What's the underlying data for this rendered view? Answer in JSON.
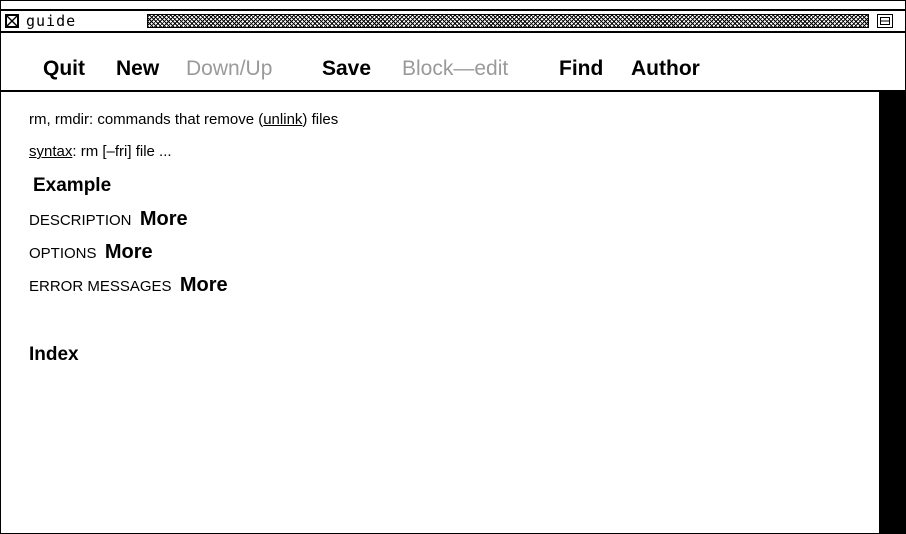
{
  "window": {
    "title": "guide"
  },
  "menu": {
    "quit": "Quit",
    "new": "New",
    "down_up": "Down/Up",
    "save": "Save",
    "block_edit": "Block—edit",
    "find": "Find",
    "author": "Author"
  },
  "content": {
    "line1_prefix": "rm, rmdir: commands that remove (",
    "line1_link": "unlink",
    "line1_suffix": ") files",
    "syntax_link": "syntax",
    "syntax_text": ":  rm [–fri] file ...",
    "example": "Example",
    "description_label": "DESCRIPTION",
    "options_label": "OPTIONS",
    "error_label": "ERROR MESSAGES",
    "more": "More",
    "index": "Index"
  },
  "colors": {
    "disabled": "#9a9a9a",
    "foreground": "#000000",
    "background": "#ffffff"
  }
}
